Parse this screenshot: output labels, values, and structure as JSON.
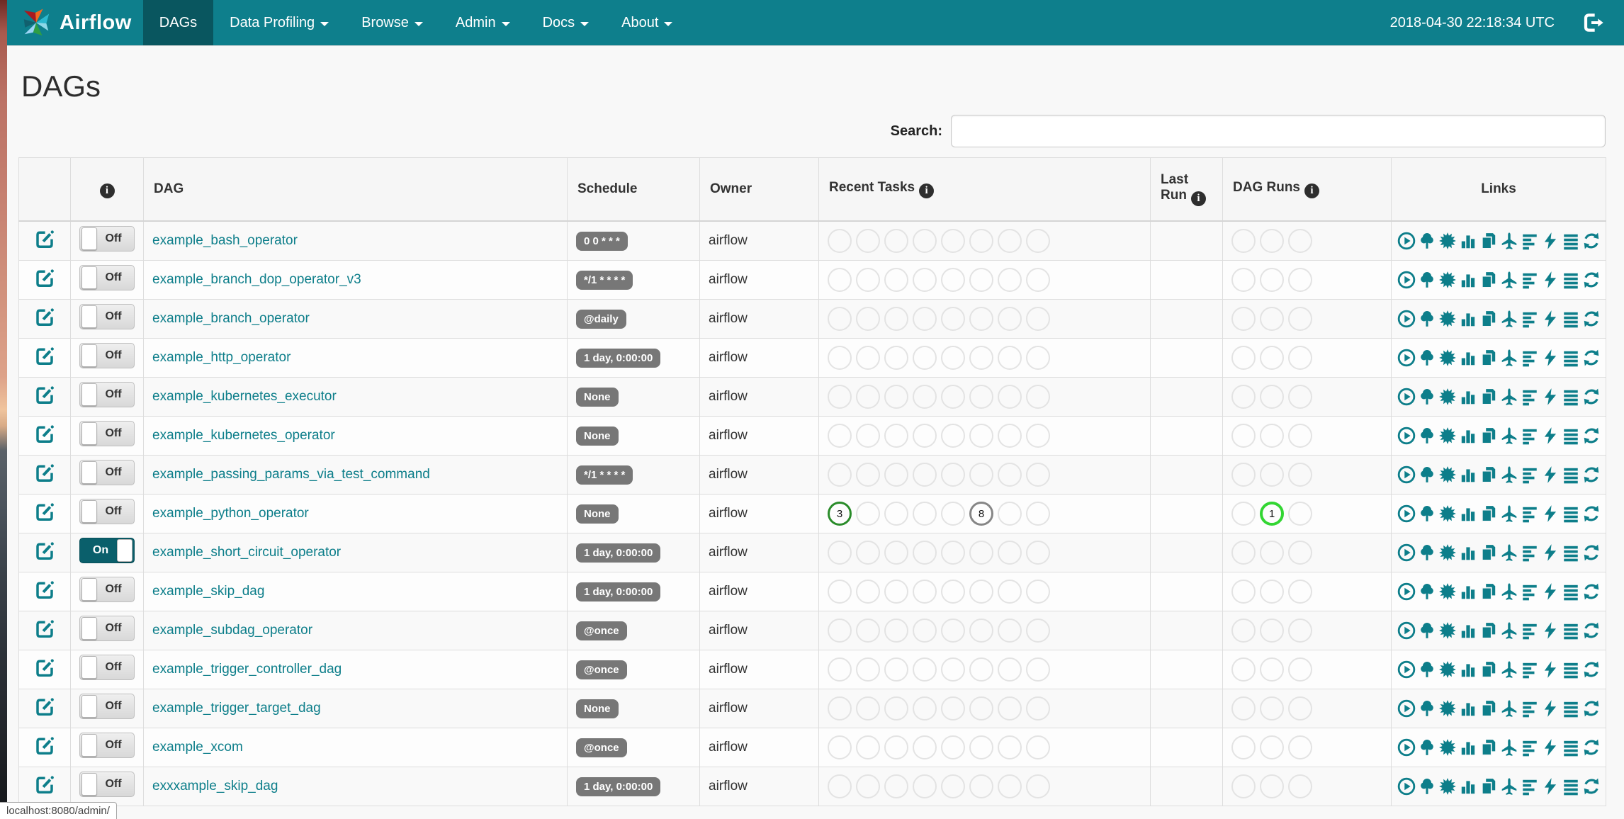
{
  "navbar": {
    "brand": "Airflow",
    "items": [
      {
        "label": "DAGs",
        "active": true,
        "caret": false
      },
      {
        "label": "Data Profiling",
        "active": false,
        "caret": true
      },
      {
        "label": "Browse",
        "active": false,
        "caret": true
      },
      {
        "label": "Admin",
        "active": false,
        "caret": true
      },
      {
        "label": "Docs",
        "active": false,
        "caret": true
      },
      {
        "label": "About",
        "active": false,
        "caret": true
      }
    ],
    "clock": "2018-04-30 22:18:34 UTC"
  },
  "page": {
    "title": "DAGs",
    "search_label": "Search:",
    "search_value": "",
    "status_bar": "localhost:8080/admin/"
  },
  "table": {
    "headers": {
      "dag": "DAG",
      "schedule": "Schedule",
      "owner": "Owner",
      "recent_tasks": "Recent Tasks",
      "last_run": "Last Run",
      "dag_runs": "DAG Runs",
      "links": "Links"
    },
    "recent_slots": 8,
    "dag_run_slots": 3,
    "link_icons": [
      "trigger-dag",
      "tree-view",
      "graph-view",
      "task-duration",
      "task-tries",
      "landing-times",
      "gantt-view",
      "code-view",
      "logs",
      "refresh"
    ],
    "rows": [
      {
        "dag": "example_bash_operator",
        "toggle": "Off",
        "schedule": "0 0 * * *",
        "owner": "airflow",
        "recent_tasks": [],
        "dag_runs": []
      },
      {
        "dag": "example_branch_dop_operator_v3",
        "toggle": "Off",
        "schedule": "*/1 * * * *",
        "owner": "airflow",
        "recent_tasks": [],
        "dag_runs": []
      },
      {
        "dag": "example_branch_operator",
        "toggle": "Off",
        "schedule": "@daily",
        "owner": "airflow",
        "recent_tasks": [],
        "dag_runs": []
      },
      {
        "dag": "example_http_operator",
        "toggle": "Off",
        "schedule": "1 day, 0:00:00",
        "owner": "airflow",
        "recent_tasks": [],
        "dag_runs": []
      },
      {
        "dag": "example_kubernetes_executor",
        "toggle": "Off",
        "schedule": "None",
        "owner": "airflow",
        "recent_tasks": [],
        "dag_runs": []
      },
      {
        "dag": "example_kubernetes_operator",
        "toggle": "Off",
        "schedule": "None",
        "owner": "airflow",
        "recent_tasks": [],
        "dag_runs": []
      },
      {
        "dag": "example_passing_params_via_test_command",
        "toggle": "Off",
        "schedule": "*/1 * * * *",
        "owner": "airflow",
        "recent_tasks": [],
        "dag_runs": []
      },
      {
        "dag": "example_python_operator",
        "toggle": "Off",
        "schedule": "None",
        "owner": "airflow",
        "recent_tasks": [
          {
            "slot": 0,
            "count": "3",
            "state": "success"
          },
          {
            "slot": 5,
            "count": "8",
            "state": "queued"
          }
        ],
        "dag_runs": [
          {
            "slot": 1,
            "count": "1",
            "state": "running"
          }
        ]
      },
      {
        "dag": "example_short_circuit_operator",
        "toggle": "On",
        "schedule": "1 day, 0:00:00",
        "owner": "airflow",
        "recent_tasks": [],
        "dag_runs": []
      },
      {
        "dag": "example_skip_dag",
        "toggle": "Off",
        "schedule": "1 day, 0:00:00",
        "owner": "airflow",
        "recent_tasks": [],
        "dag_runs": []
      },
      {
        "dag": "example_subdag_operator",
        "toggle": "Off",
        "schedule": "@once",
        "owner": "airflow",
        "recent_tasks": [],
        "dag_runs": []
      },
      {
        "dag": "example_trigger_controller_dag",
        "toggle": "Off",
        "schedule": "@once",
        "owner": "airflow",
        "recent_tasks": [],
        "dag_runs": []
      },
      {
        "dag": "example_trigger_target_dag",
        "toggle": "Off",
        "schedule": "None",
        "owner": "airflow",
        "recent_tasks": [],
        "dag_runs": []
      },
      {
        "dag": "example_xcom",
        "toggle": "Off",
        "schedule": "@once",
        "owner": "airflow",
        "recent_tasks": [],
        "dag_runs": []
      },
      {
        "dag": "exxxample_skip_dag",
        "toggle": "Off",
        "schedule": "1 day, 0:00:00",
        "owner": "airflow",
        "recent_tasks": [],
        "dag_runs": []
      }
    ]
  },
  "colors": {
    "navbar_teal": "#0e7f8c",
    "active_tab_teal": "#09565f",
    "accent_teal": "#0d7e8a",
    "success_green": "#2a8c2a",
    "running_green": "#33d633",
    "queued_grey": "#868686",
    "badge_grey": "#777777"
  }
}
